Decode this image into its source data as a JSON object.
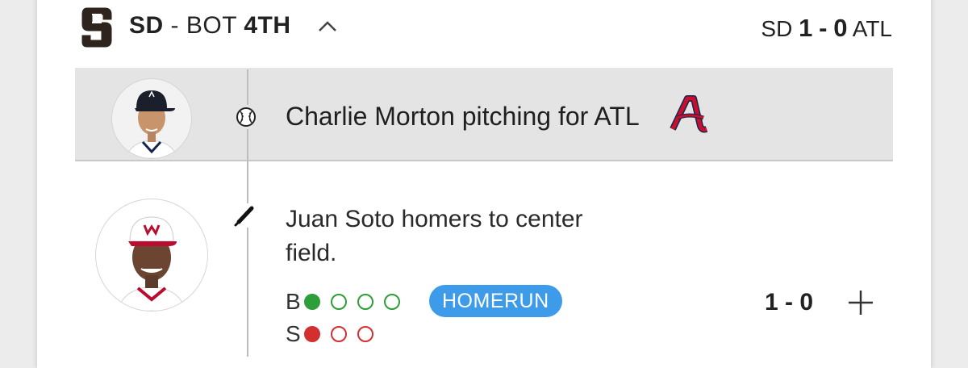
{
  "header": {
    "team": "SD",
    "separator": " - ",
    "half": "BOT ",
    "inning": "4TH",
    "score": {
      "home_team": "SD",
      "home_runs": "1",
      "dash": "-",
      "away_runs": "0",
      "away_team": "ATL"
    }
  },
  "pitching": {
    "text": "Charlie Morton pitching for ATL"
  },
  "play": {
    "text": "Juan Soto homers to center field.",
    "balls_label": "B",
    "strikes_label": "S",
    "balls": 1,
    "balls_max": 4,
    "strikes": 1,
    "strikes_max": 3,
    "badge": "HOMERUN",
    "score": "1 - 0"
  },
  "colors": {
    "ball": "#2e9e3a",
    "strike": "#d32f2f",
    "badge": "#3d9be9",
    "atl_red": "#c8102e",
    "atl_navy": "#13274f"
  },
  "icons": {
    "team_logo": "padres-sd-logo-icon",
    "collapse": "chevron-up-icon",
    "pitch": "baseball-icon",
    "hit": "bat-icon",
    "opponent": "braves-a-logo-icon",
    "expand": "plus-icon"
  }
}
